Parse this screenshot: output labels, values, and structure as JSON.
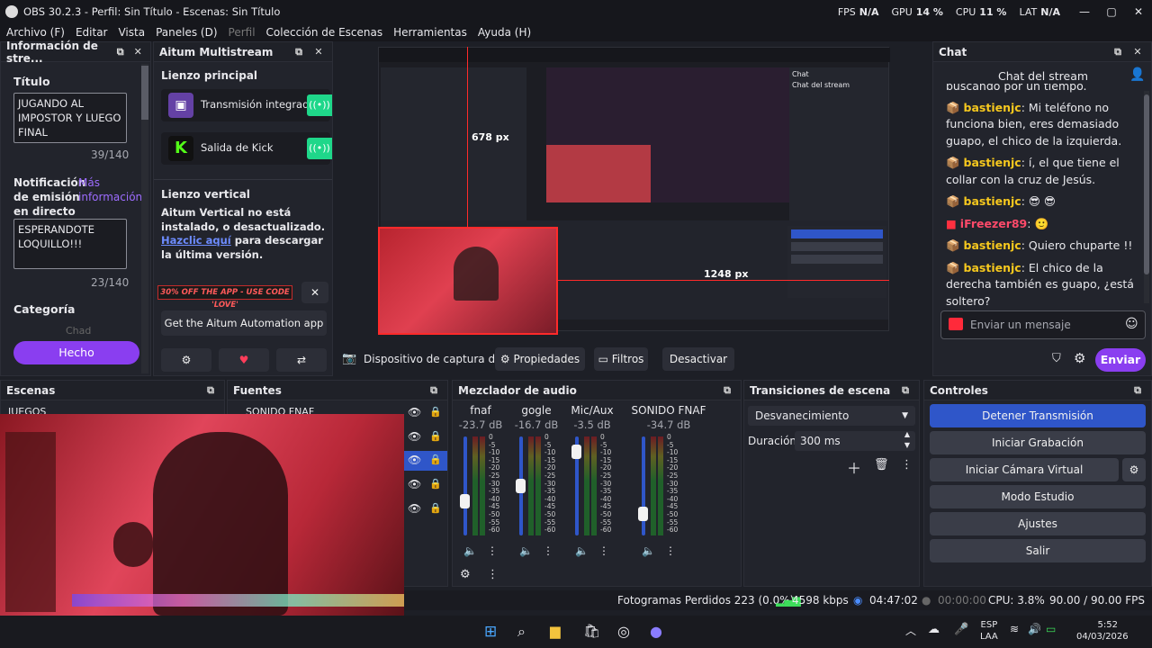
{
  "titlebar": {
    "title": "OBS 30.2.3 - Perfil: Sin Título - Escenas: Sin Título",
    "fps_label": "FPS",
    "fps_val": "N/A",
    "gpu_label": "GPU",
    "gpu_val": "14 %",
    "cpu_label": "CPU",
    "cpu_val": "11 %",
    "lat_label": "LAT",
    "lat_val": "N/A"
  },
  "menu": [
    "Archivo (F)",
    "Editar",
    "Vista",
    "Paneles (D)",
    "Perfil",
    "Colección de Escenas",
    "Herramientas",
    "Ayuda (H)"
  ],
  "streaminfo": {
    "header": "Información de stre...",
    "title_label": "Título",
    "title_value": "JUGANDO AL IMPOSTOR Y LUEGO FINAL",
    "title_count": "39/140",
    "notif_label": "Notificación de emisión en directo",
    "notif_more": "Más información",
    "notif_value": "ESPERANDOTE LOQUILLO!!!",
    "notif_count": "23/140",
    "category_label": "Categoría",
    "category_value": "Chad",
    "done_label": "Hecho"
  },
  "aitum": {
    "header": "Aitum Multistream",
    "main_canvas": "Lienzo principal",
    "out1": "Transmisión integrada",
    "out2": "Salida de Kick",
    "vertical": "Lienzo vertical",
    "vertical_msg": "Aitum Vertical no está instalado, o desactualizado.",
    "vertical_link": "Hazclic aquí",
    "vertical_after": " para descargar la última versión.",
    "promo": "30% OFF THE APP - USE CODE 'LOVE'",
    "promo_close": "✕",
    "automation_btn": "Get the Aitum Automation app"
  },
  "preview": {
    "label_w": "678 px",
    "label_h": "1248 px",
    "source_name": "Dispositivo de captura de v",
    "props": "Propiedades",
    "filters": "Filtros",
    "deactivate": "Desactivar",
    "inner_chat": "Chat",
    "inner_chat_title": "Chat del stream"
  },
  "chat": {
    "header": "Chat",
    "title": "Chat del stream",
    "top_line": "buscando por un tiempo.",
    "messages": [
      {
        "user": "bastienjc",
        "text": "Mi teléfono no funciona bien, eres demasiado guapo, el chico de la izquierda."
      },
      {
        "user": "bastienjc",
        "text": "í, el que tiene el collar con la cruz de Jesús."
      },
      {
        "user": "bastienjc",
        "text": "😎 😎"
      },
      {
        "user": "iFreezer89",
        "text": ""
      },
      {
        "user": "bastienjc",
        "text": "Quiero chuparte !!"
      },
      {
        "user": "bastienjc",
        "text": "El chico de la derecha también es guapo, ¿está soltero?"
      }
    ],
    "input_placeholder": "Enviar un mensaje",
    "send": "Enviar"
  },
  "scenes": {
    "header": "Escenas",
    "first": "JUEGOS"
  },
  "sources": {
    "header": "Fuentes",
    "first": "SONIDO FNAF"
  },
  "mixer": {
    "header": "Mezclador de audio",
    "channels": [
      {
        "name": "fnaf",
        "db": "-23.7 dB",
        "level": 0.35
      },
      {
        "name": "gogle",
        "db": "-16.7 dB",
        "level": 0.5
      },
      {
        "name": "Mic/Aux",
        "db": "-3.5 dB",
        "level": 0.85
      },
      {
        "name": "SONIDO FNAF",
        "db": "-34.7 dB",
        "level": 0.22
      }
    ],
    "scale": [
      "0",
      "-5",
      "-10",
      "-15",
      "-20",
      "-25",
      "-30",
      "-35",
      "-40",
      "-45",
      "-50",
      "-55",
      "-60"
    ]
  },
  "transitions": {
    "header": "Transiciones de escena",
    "selected": "Desvanecimiento",
    "duration_label": "Duración",
    "duration_value": "300 ms"
  },
  "controls": {
    "header": "Controles",
    "buttons": [
      "Detener Transmisión",
      "Iniciar Grabación",
      "Iniciar Cámara Virtual",
      "Modo Estudio",
      "Ajustes",
      "Salir"
    ]
  },
  "status": {
    "dropped": "Fotogramas Perdidos 223 (0.0%)",
    "kbps": "4598 kbps",
    "stream_time": "04:47:02",
    "rec_time": "00:00:00",
    "cpu": "CPU: 3.8%",
    "fps": "90.00 / 90.00 FPS"
  },
  "taskbar": {
    "lang1": "ESP",
    "lang2": "LAA",
    "time": "5:52",
    "date": "04/03/2026"
  },
  "colors": {
    "accent": "#8a3ef0",
    "active_control": "#2f56c9",
    "chat_user": "#f6c81e",
    "twitch": "#6441a5",
    "kick": "#53fc18"
  }
}
